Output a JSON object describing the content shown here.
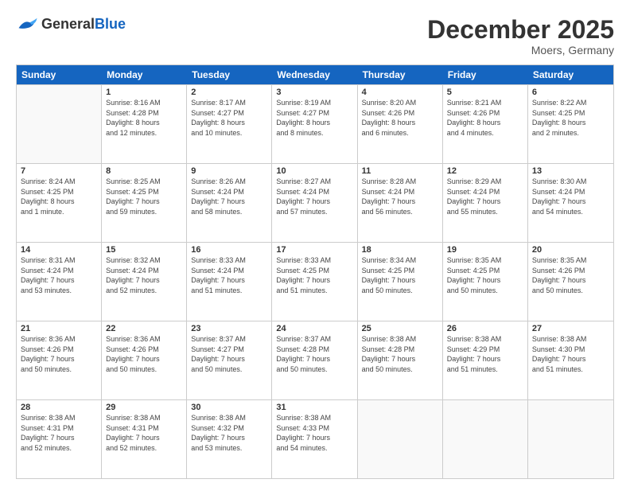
{
  "header": {
    "logo_general": "General",
    "logo_blue": "Blue",
    "month": "December 2025",
    "location": "Moers, Germany"
  },
  "days_of_week": [
    "Sunday",
    "Monday",
    "Tuesday",
    "Wednesday",
    "Thursday",
    "Friday",
    "Saturday"
  ],
  "weeks": [
    [
      {
        "day": "",
        "info": ""
      },
      {
        "day": "1",
        "info": "Sunrise: 8:16 AM\nSunset: 4:28 PM\nDaylight: 8 hours\nand 12 minutes."
      },
      {
        "day": "2",
        "info": "Sunrise: 8:17 AM\nSunset: 4:27 PM\nDaylight: 8 hours\nand 10 minutes."
      },
      {
        "day": "3",
        "info": "Sunrise: 8:19 AM\nSunset: 4:27 PM\nDaylight: 8 hours\nand 8 minutes."
      },
      {
        "day": "4",
        "info": "Sunrise: 8:20 AM\nSunset: 4:26 PM\nDaylight: 8 hours\nand 6 minutes."
      },
      {
        "day": "5",
        "info": "Sunrise: 8:21 AM\nSunset: 4:26 PM\nDaylight: 8 hours\nand 4 minutes."
      },
      {
        "day": "6",
        "info": "Sunrise: 8:22 AM\nSunset: 4:25 PM\nDaylight: 8 hours\nand 2 minutes."
      }
    ],
    [
      {
        "day": "7",
        "info": "Sunrise: 8:24 AM\nSunset: 4:25 PM\nDaylight: 8 hours\nand 1 minute."
      },
      {
        "day": "8",
        "info": "Sunrise: 8:25 AM\nSunset: 4:25 PM\nDaylight: 7 hours\nand 59 minutes."
      },
      {
        "day": "9",
        "info": "Sunrise: 8:26 AM\nSunset: 4:24 PM\nDaylight: 7 hours\nand 58 minutes."
      },
      {
        "day": "10",
        "info": "Sunrise: 8:27 AM\nSunset: 4:24 PM\nDaylight: 7 hours\nand 57 minutes."
      },
      {
        "day": "11",
        "info": "Sunrise: 8:28 AM\nSunset: 4:24 PM\nDaylight: 7 hours\nand 56 minutes."
      },
      {
        "day": "12",
        "info": "Sunrise: 8:29 AM\nSunset: 4:24 PM\nDaylight: 7 hours\nand 55 minutes."
      },
      {
        "day": "13",
        "info": "Sunrise: 8:30 AM\nSunset: 4:24 PM\nDaylight: 7 hours\nand 54 minutes."
      }
    ],
    [
      {
        "day": "14",
        "info": "Sunrise: 8:31 AM\nSunset: 4:24 PM\nDaylight: 7 hours\nand 53 minutes."
      },
      {
        "day": "15",
        "info": "Sunrise: 8:32 AM\nSunset: 4:24 PM\nDaylight: 7 hours\nand 52 minutes."
      },
      {
        "day": "16",
        "info": "Sunrise: 8:33 AM\nSunset: 4:24 PM\nDaylight: 7 hours\nand 51 minutes."
      },
      {
        "day": "17",
        "info": "Sunrise: 8:33 AM\nSunset: 4:25 PM\nDaylight: 7 hours\nand 51 minutes."
      },
      {
        "day": "18",
        "info": "Sunrise: 8:34 AM\nSunset: 4:25 PM\nDaylight: 7 hours\nand 50 minutes."
      },
      {
        "day": "19",
        "info": "Sunrise: 8:35 AM\nSunset: 4:25 PM\nDaylight: 7 hours\nand 50 minutes."
      },
      {
        "day": "20",
        "info": "Sunrise: 8:35 AM\nSunset: 4:26 PM\nDaylight: 7 hours\nand 50 minutes."
      }
    ],
    [
      {
        "day": "21",
        "info": "Sunrise: 8:36 AM\nSunset: 4:26 PM\nDaylight: 7 hours\nand 50 minutes."
      },
      {
        "day": "22",
        "info": "Sunrise: 8:36 AM\nSunset: 4:26 PM\nDaylight: 7 hours\nand 50 minutes."
      },
      {
        "day": "23",
        "info": "Sunrise: 8:37 AM\nSunset: 4:27 PM\nDaylight: 7 hours\nand 50 minutes."
      },
      {
        "day": "24",
        "info": "Sunrise: 8:37 AM\nSunset: 4:28 PM\nDaylight: 7 hours\nand 50 minutes."
      },
      {
        "day": "25",
        "info": "Sunrise: 8:38 AM\nSunset: 4:28 PM\nDaylight: 7 hours\nand 50 minutes."
      },
      {
        "day": "26",
        "info": "Sunrise: 8:38 AM\nSunset: 4:29 PM\nDaylight: 7 hours\nand 51 minutes."
      },
      {
        "day": "27",
        "info": "Sunrise: 8:38 AM\nSunset: 4:30 PM\nDaylight: 7 hours\nand 51 minutes."
      }
    ],
    [
      {
        "day": "28",
        "info": "Sunrise: 8:38 AM\nSunset: 4:31 PM\nDaylight: 7 hours\nand 52 minutes."
      },
      {
        "day": "29",
        "info": "Sunrise: 8:38 AM\nSunset: 4:31 PM\nDaylight: 7 hours\nand 52 minutes."
      },
      {
        "day": "30",
        "info": "Sunrise: 8:38 AM\nSunset: 4:32 PM\nDaylight: 7 hours\nand 53 minutes."
      },
      {
        "day": "31",
        "info": "Sunrise: 8:38 AM\nSunset: 4:33 PM\nDaylight: 7 hours\nand 54 minutes."
      },
      {
        "day": "",
        "info": ""
      },
      {
        "day": "",
        "info": ""
      },
      {
        "day": "",
        "info": ""
      }
    ]
  ]
}
